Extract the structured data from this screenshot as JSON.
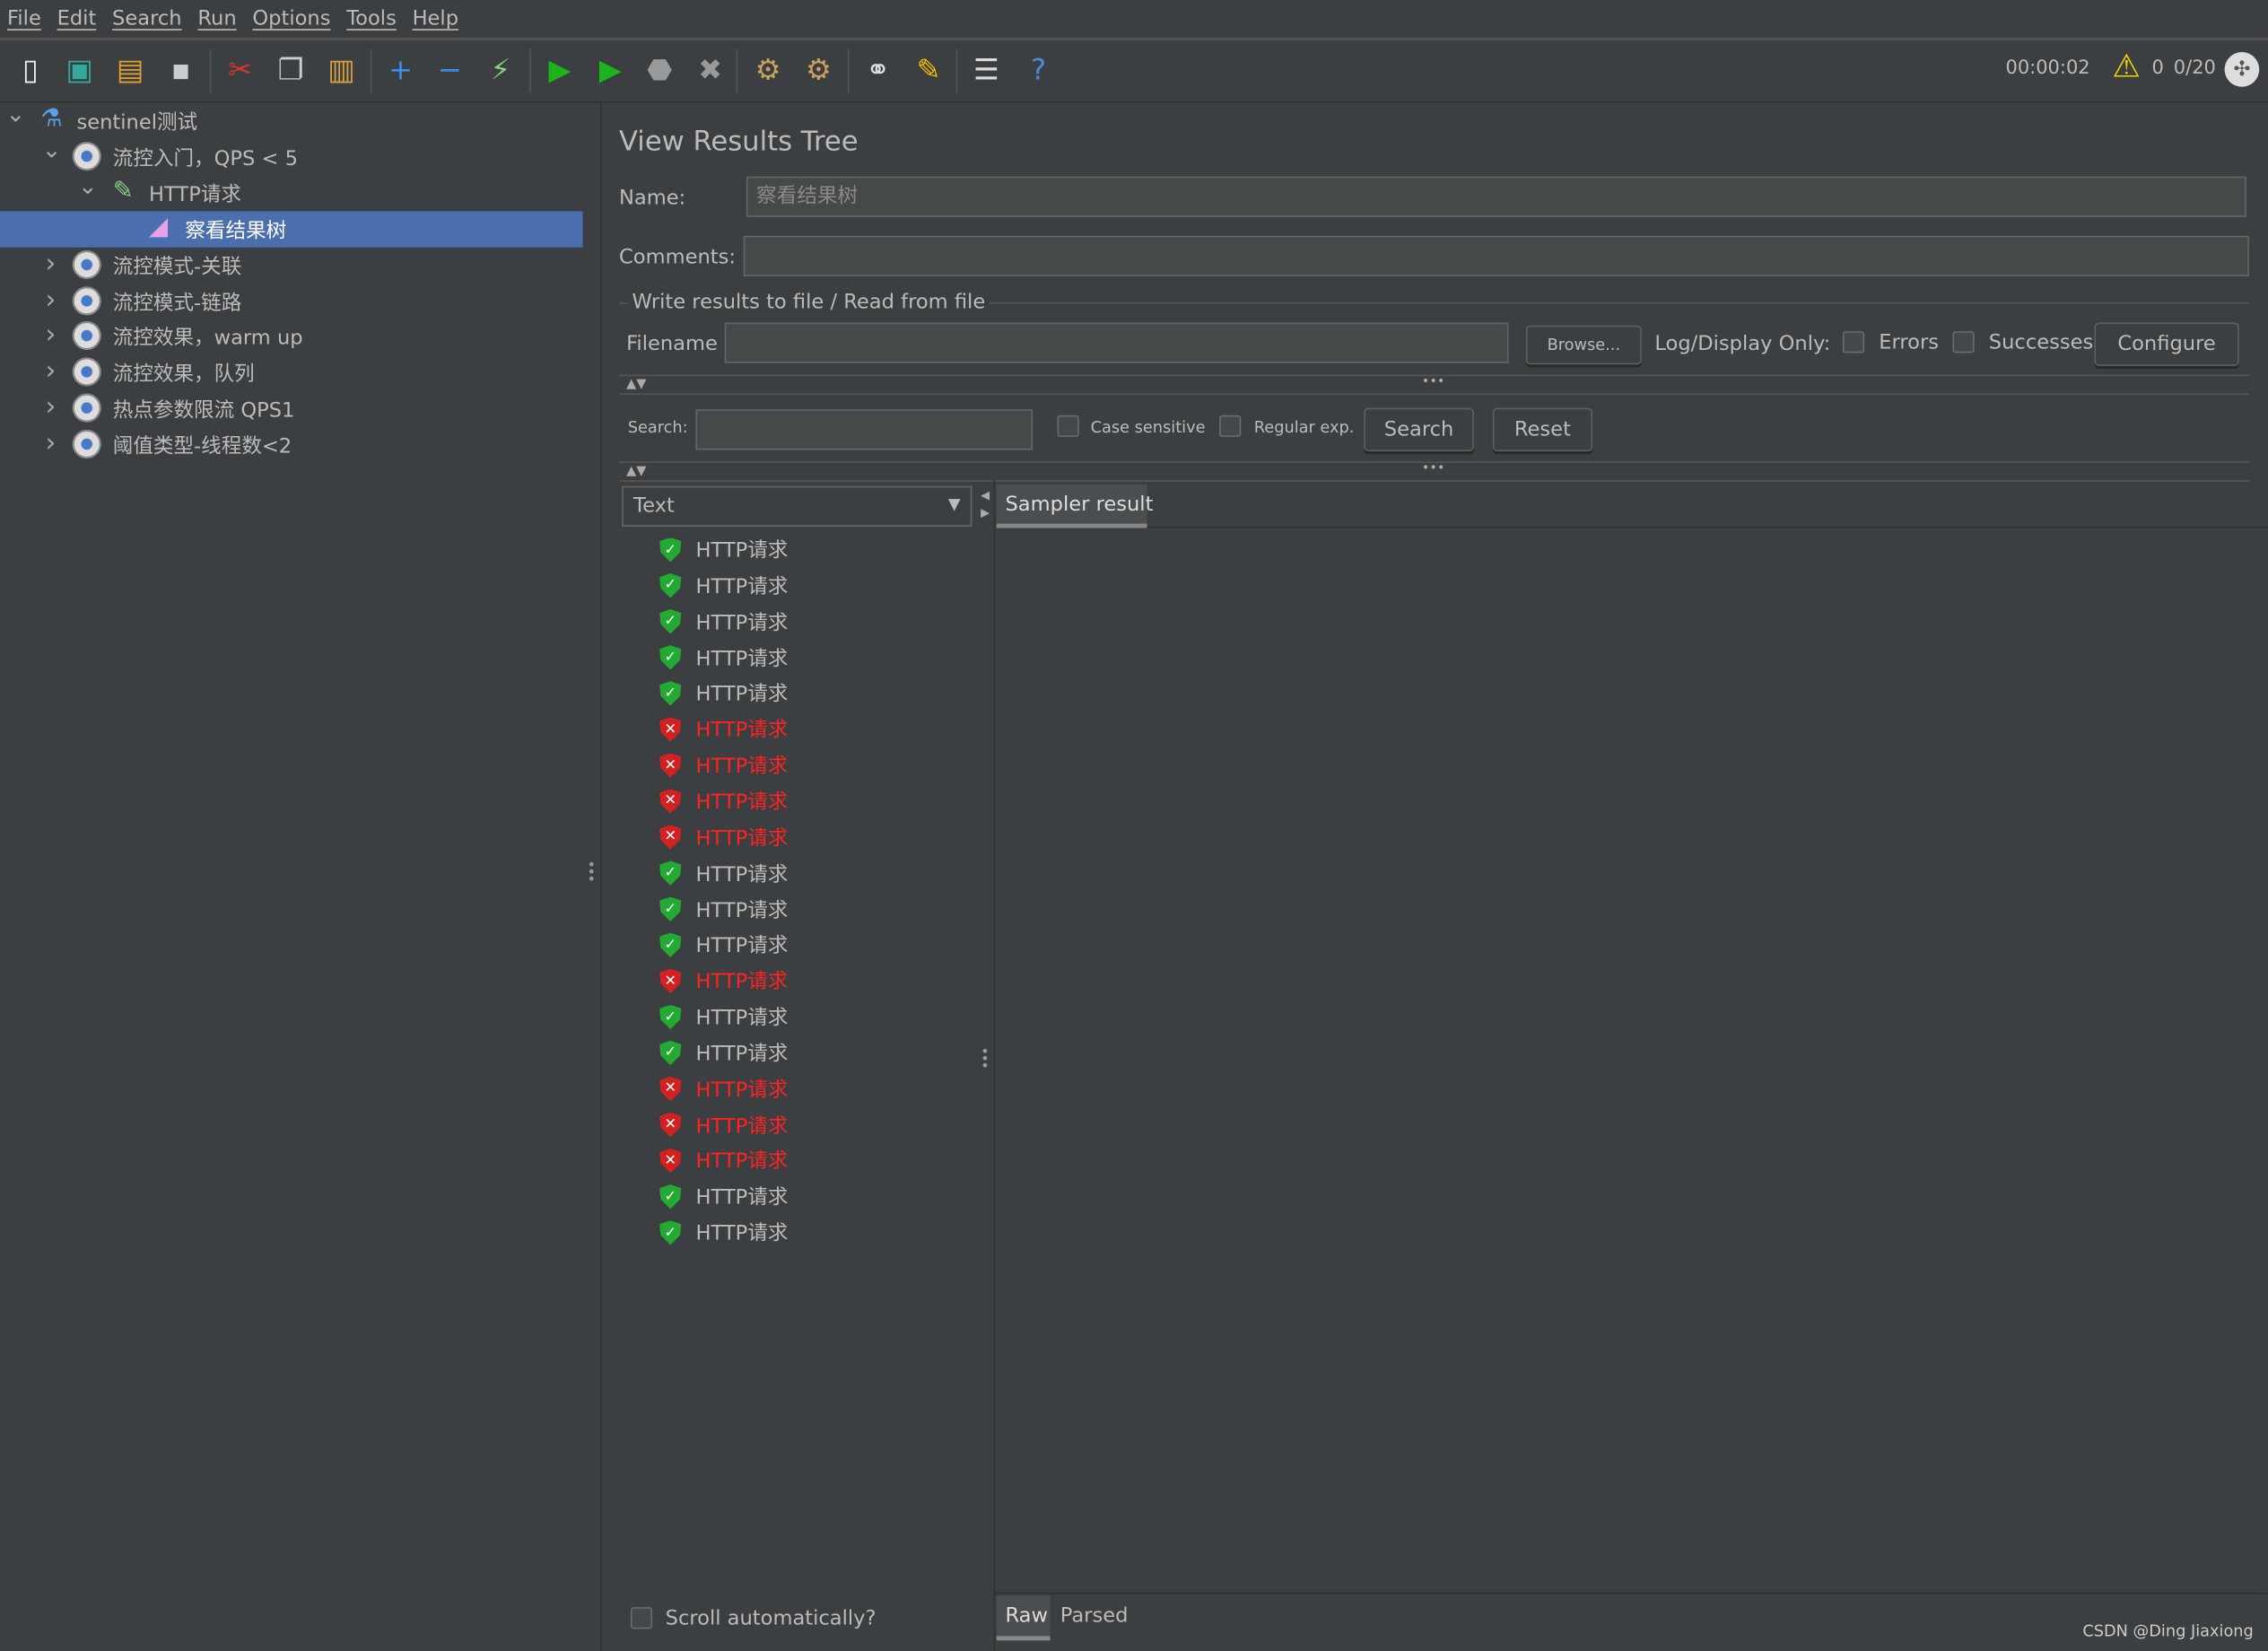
{
  "menu": [
    "File",
    "Edit",
    "Search",
    "Run",
    "Options",
    "Tools",
    "Help"
  ],
  "toolbar": {
    "icons": [
      "new-icon",
      "templates-icon",
      "open-icon",
      "save-icon",
      "cut-icon",
      "copy-icon",
      "paste-icon",
      "expand-icon",
      "collapse-icon",
      "toggle-icon",
      "start-icon",
      "start-no-pauses-icon",
      "stop-icon",
      "shutdown-icon",
      "clear-icon",
      "clear-all-icon",
      "search-icon",
      "reset-search-icon",
      "function-helper-icon",
      "help-icon"
    ],
    "elapsed": "00:00:02",
    "warnings": "0",
    "threads": "0/20"
  },
  "tree": [
    {
      "label": "sentinel测试",
      "level": 0,
      "expanded": true,
      "icon": "test-plan-icon"
    },
    {
      "label": "流控入门，QPS < 5",
      "level": 1,
      "expanded": true,
      "icon": "thread-group-icon"
    },
    {
      "label": "HTTP请求",
      "level": 2,
      "expanded": true,
      "icon": "sampler-icon"
    },
    {
      "label": "察看结果树",
      "level": 3,
      "selected": true,
      "icon": "listener-icon"
    },
    {
      "label": "流控模式-关联",
      "level": 1,
      "expanded": false,
      "icon": "thread-group-icon"
    },
    {
      "label": "流控模式-链路",
      "level": 1,
      "expanded": false,
      "icon": "thread-group-icon"
    },
    {
      "label": "流控效果，warm up",
      "level": 1,
      "expanded": false,
      "icon": "thread-group-icon"
    },
    {
      "label": "流控效果，队列",
      "level": 1,
      "expanded": false,
      "icon": "thread-group-icon"
    },
    {
      "label": "热点参数限流 QPS1",
      "level": 1,
      "expanded": false,
      "icon": "thread-group-icon"
    },
    {
      "label": "阈值类型-线程数<2",
      "level": 1,
      "expanded": false,
      "icon": "thread-group-icon"
    }
  ],
  "panel": {
    "title": "View Results Tree",
    "name_label": "Name:",
    "name_value": "察看结果树",
    "comments_label": "Comments:",
    "comments_value": "",
    "file_section": "Write results to file / Read from file",
    "filename_label": "Filename",
    "filename_value": "",
    "browse": "Browse...",
    "log_display": "Log/Display Only:",
    "errors": "Errors",
    "successes": "Successes",
    "configure": "Configure",
    "search_label": "Search:",
    "search_value": "",
    "case_sensitive": "Case sensitive",
    "regexp": "Regular exp.",
    "search_btn": "Search",
    "reset_btn": "Reset",
    "renderer": "Text",
    "tab_sampler": "Sampler result",
    "scroll_auto": "Scroll automatically?",
    "tab_raw": "Raw",
    "tab_parsed": "Parsed"
  },
  "results": [
    {
      "label": "HTTP请求",
      "status": "ok"
    },
    {
      "label": "HTTP请求",
      "status": "ok"
    },
    {
      "label": "HTTP请求",
      "status": "ok"
    },
    {
      "label": "HTTP请求",
      "status": "ok"
    },
    {
      "label": "HTTP请求",
      "status": "ok"
    },
    {
      "label": "HTTP请求",
      "status": "error"
    },
    {
      "label": "HTTP请求",
      "status": "error"
    },
    {
      "label": "HTTP请求",
      "status": "error"
    },
    {
      "label": "HTTP请求",
      "status": "error"
    },
    {
      "label": "HTTP请求",
      "status": "ok"
    },
    {
      "label": "HTTP请求",
      "status": "ok"
    },
    {
      "label": "HTTP请求",
      "status": "ok"
    },
    {
      "label": "HTTP请求",
      "status": "error"
    },
    {
      "label": "HTTP请求",
      "status": "ok"
    },
    {
      "label": "HTTP请求",
      "status": "ok"
    },
    {
      "label": "HTTP请求",
      "status": "error"
    },
    {
      "label": "HTTP请求",
      "status": "error"
    },
    {
      "label": "HTTP请求",
      "status": "error"
    },
    {
      "label": "HTTP请求",
      "status": "ok"
    },
    {
      "label": "HTTP请求",
      "status": "ok"
    }
  ],
  "watermark": "CSDN @Ding Jiaxiong",
  "colors": {
    "background": "#3c3f41",
    "selection": "#4b6eaf",
    "error_text": "#ff2222",
    "ok_icon": "#22aa33",
    "error_icon": "#d42020"
  }
}
